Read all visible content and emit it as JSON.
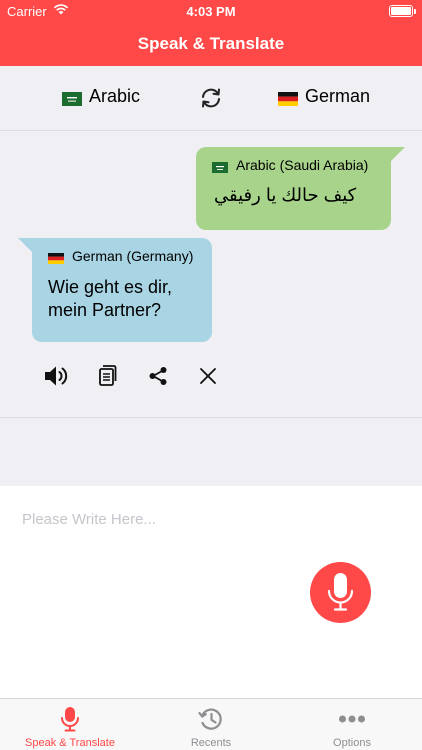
{
  "status_bar": {
    "carrier": "Carrier",
    "time": "4:03 PM"
  },
  "navbar": {
    "title": "Speak & Translate"
  },
  "languages": {
    "source": {
      "label": "Arabic",
      "flag": "saudi-arabia-flag"
    },
    "target": {
      "label": "German",
      "flag": "germany-flag"
    },
    "swap_icon": "swap-refresh-icon"
  },
  "conversation": [
    {
      "language": "Arabic (Saudi Arabia)",
      "text": "كيف حالك يا رفيقي",
      "color": "#a7d48a",
      "side": "right"
    },
    {
      "language": "German (Germany)",
      "text": "Wie geht es dir, mein Partner?",
      "color": "#a8d4e4",
      "side": "left"
    }
  ],
  "actions": [
    "speaker-icon",
    "copy-icon",
    "share-icon",
    "close-icon"
  ],
  "input": {
    "placeholder": "Please Write Here...",
    "value": ""
  },
  "mic_button": {
    "icon": "microphone-icon"
  },
  "tabs": [
    {
      "label": "Speak & Translate",
      "icon": "microphone-icon",
      "active": true
    },
    {
      "label": "Recents",
      "icon": "history-icon",
      "active": false
    },
    {
      "label": "Options",
      "icon": "more-icon",
      "active": false
    }
  ],
  "colors": {
    "accent": "#ff4848",
    "background": "#efeff4",
    "inactive_tab": "#8e8e93"
  }
}
